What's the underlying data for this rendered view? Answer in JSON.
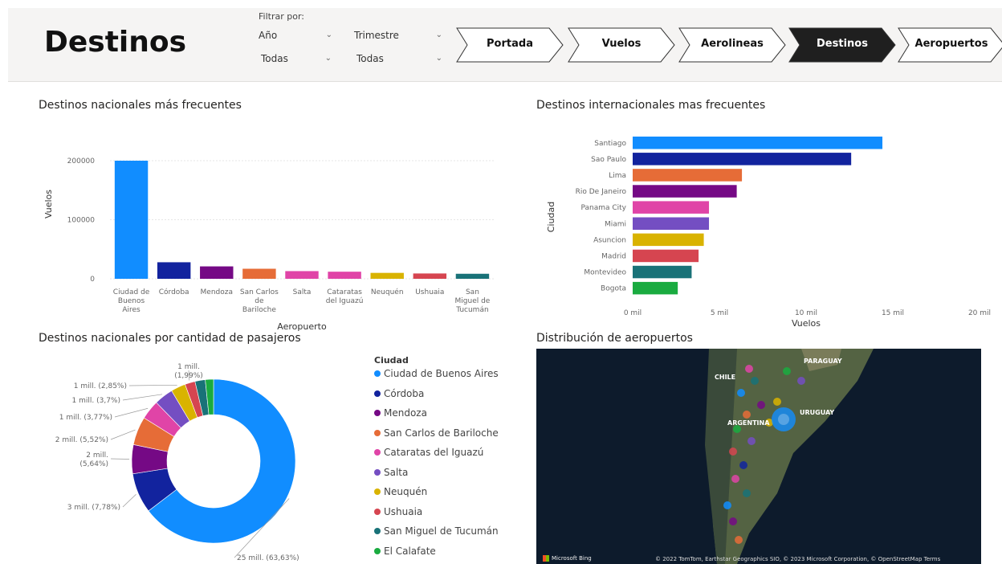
{
  "header": {
    "title": "Destinos",
    "filter_label": "Filtrar por:",
    "slicers": [
      {
        "label": "Año",
        "value": "Todas"
      },
      {
        "label": "Trimestre",
        "value": "Todas"
      }
    ],
    "nav": [
      {
        "label": "Portada",
        "active": false
      },
      {
        "label": "Vuelos",
        "active": false
      },
      {
        "label": "Aerolineas",
        "active": false
      },
      {
        "label": "Destinos",
        "active": true
      },
      {
        "label": "Aeropuertos",
        "active": false
      }
    ]
  },
  "visuals": {
    "national_title": "Destinos nacionales más frecuentes",
    "international_title": "Destinos internacionales mas frecuentes",
    "passengers_title": "Destinos nacionales por cantidad de pasajeros",
    "map_title": "Distribución de aeropuertos"
  },
  "chart_data": [
    {
      "type": "bar",
      "title": "Destinos nacionales más frecuentes",
      "xlabel": "Aeropuerto",
      "ylabel": "Vuelos",
      "ylim": [
        0,
        200000
      ],
      "yticks": [
        "0",
        "100000",
        "200000"
      ],
      "categories": [
        "Ciudad de Buenos Aires",
        "Córdoba",
        "Mendoza",
        "San Carlos de Bariloche",
        "Salta",
        "Cataratas del Iguazú",
        "Neuquén",
        "Ushuaia",
        "San Miguel de Tucumán"
      ],
      "category_lines": [
        [
          "Ciudad de",
          "Buenos",
          "Aires"
        ],
        [
          "Córdoba"
        ],
        [
          "Mendoza"
        ],
        [
          "San Carlos",
          "de",
          "Bariloche"
        ],
        [
          "Salta"
        ],
        [
          "Cataratas",
          "del Iguazú"
        ],
        [
          "Neuquén"
        ],
        [
          "Ushuaia"
        ],
        [
          "San",
          "Miguel de",
          "Tucumán"
        ]
      ],
      "values": [
        200000,
        28000,
        21000,
        17000,
        13000,
        12000,
        10000,
        9000,
        8500
      ],
      "colors": [
        "#118DFF",
        "#12239E",
        "#750985",
        "#E66C37",
        "#E044A7",
        "#E044A7",
        "#D9B300",
        "#D64550",
        "#197278"
      ],
      "grid": true
    },
    {
      "type": "bar",
      "orientation": "horizontal",
      "title": "Destinos internacionales mas frecuentes",
      "xlabel": "Vuelos",
      "ylabel": "Ciudad",
      "xlim": [
        0,
        20000
      ],
      "xticks": [
        "0 mil",
        "5 mil",
        "10 mil",
        "15 mil",
        "20 mil"
      ],
      "categories": [
        "Santiago",
        "Sao Paulo",
        "Lima",
        "Rio De Janeiro",
        "Panama City",
        "Miami",
        "Asuncion",
        "Madrid",
        "Montevideo",
        "Bogota"
      ],
      "values": [
        14400,
        12600,
        6300,
        6000,
        4400,
        4400,
        4100,
        3800,
        3400,
        2600
      ],
      "colors": [
        "#118DFF",
        "#12239E",
        "#E66C37",
        "#750985",
        "#E044A7",
        "#744EC2",
        "#D9B300",
        "#D64550",
        "#197278",
        "#1AAB40"
      ]
    },
    {
      "type": "pie",
      "donut": true,
      "title": "Destinos nacionales por cantidad de pasajeros",
      "legend_title": "Ciudad",
      "legend_position": "right",
      "categories": [
        "Ciudad de Buenos Aires",
        "Córdoba",
        "Mendoza",
        "San Carlos de Bariloche",
        "Cataratas del Iguazú",
        "Salta",
        "Neuquén",
        "Ushuaia",
        "San Miguel de Tucumán",
        "El Calafate"
      ],
      "values": [
        63.63,
        7.78,
        5.64,
        5.52,
        3.77,
        3.7,
        2.85,
        1.99,
        1.99,
        1.6
      ],
      "colors": [
        "#118DFF",
        "#12239E",
        "#750985",
        "#E66C37",
        "#E044A7",
        "#744EC2",
        "#D9B300",
        "#D64550",
        "#197278",
        "#1AAB40"
      ],
      "data_labels": [
        "25 mill. (63,63%)",
        "3 mill. (7,78%)",
        "2 mill. (5,64%)",
        "2 mill. (5,52%)",
        "1 mill. (3,77%)",
        "1 mill. (3,7%)",
        "1 mill. (2,85%)",
        "1 mill. (1,99%)"
      ]
    }
  ],
  "map": {
    "labels": [
      "PARAGUAY",
      "CHILE",
      "ARGENTINA",
      "URUGUAY"
    ],
    "credit": "© 2022 TomTom, Earthstar Geographics SIO, © 2023 Microsoft Corporation, © OpenStreetMap  Terms",
    "bing": "Microsoft Bing",
    "bubble_color": "#118DFF"
  }
}
